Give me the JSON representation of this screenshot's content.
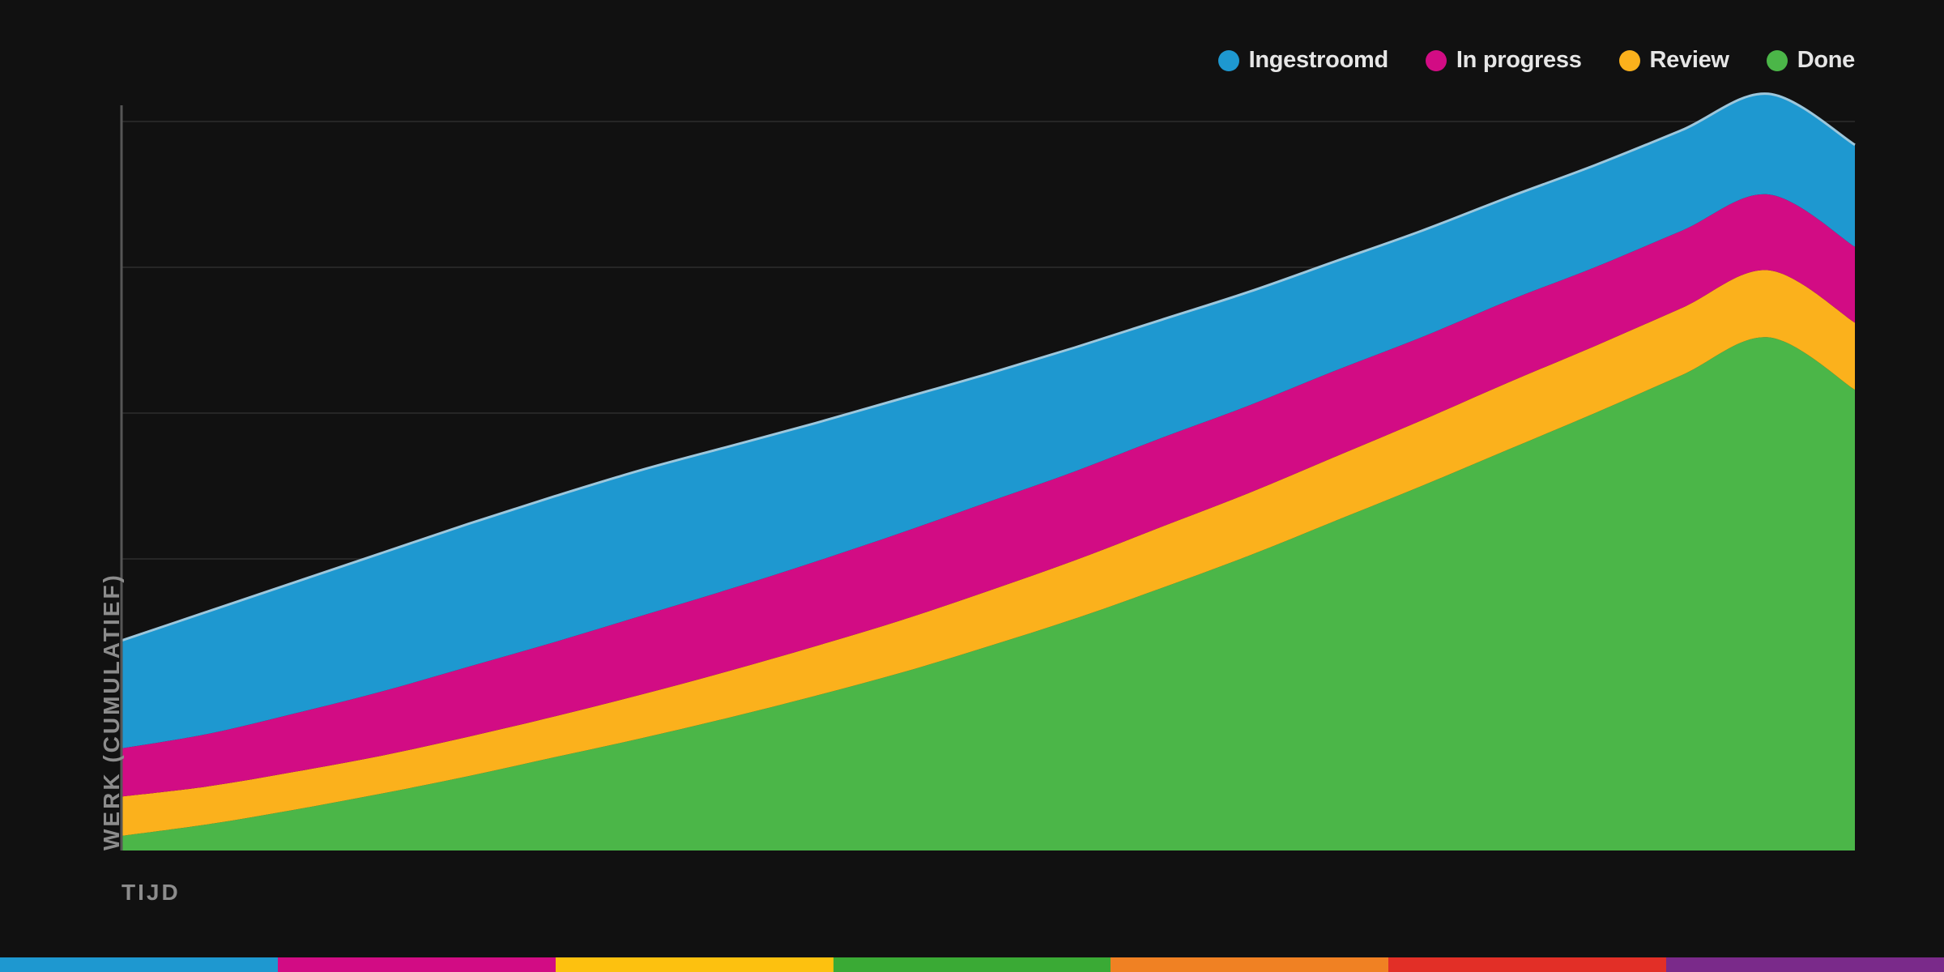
{
  "chart_data": {
    "type": "area",
    "stacked": true,
    "title": "",
    "xlabel": "TIJD",
    "ylabel": "WERK (CUMULATIEF)",
    "ylim": [
      0,
      5
    ],
    "grid": true,
    "legend_position": "top-right",
    "x": [
      0,
      1,
      2,
      3,
      4,
      5,
      6,
      7,
      8,
      9,
      10,
      11,
      12,
      13,
      14,
      15,
      16,
      17,
      18,
      19,
      20
    ],
    "series": [
      {
        "name": "Done",
        "color": "#4bb648",
        "values": [
          0.1,
          0.18,
          0.28,
          0.39,
          0.51,
          0.64,
          0.77,
          0.91,
          1.06,
          1.22,
          1.4,
          1.59,
          1.8,
          2.02,
          2.26,
          2.5,
          2.75,
          3.0,
          3.26,
          3.52,
          3.16
        ]
      },
      {
        "name": "Review",
        "color": "#fbb11c",
        "values": [
          0.27,
          0.26,
          0.26,
          0.26,
          0.27,
          0.28,
          0.3,
          0.32,
          0.34,
          0.36,
          0.38,
          0.4,
          0.42,
          0.43,
          0.44,
          0.45,
          0.46,
          0.46,
          0.46,
          0.46,
          0.46
        ]
      },
      {
        "name": "In progress",
        "color": "#d20c84",
        "values": [
          0.33,
          0.36,
          0.4,
          0.44,
          0.48,
          0.51,
          0.54,
          0.56,
          0.58,
          0.6,
          0.61,
          0.61,
          0.61,
          0.6,
          0.59,
          0.57,
          0.56,
          0.54,
          0.53,
          0.52,
          0.52
        ]
      },
      {
        "name": "Ingestroomd",
        "color": "#1e98d0",
        "values": [
          0.74,
          0.84,
          0.9,
          0.95,
          0.98,
          1.0,
          1.0,
          0.98,
          0.95,
          0.92,
          0.88,
          0.85,
          0.81,
          0.78,
          0.75,
          0.73,
          0.71,
          0.7,
          0.69,
          0.69,
          0.7
        ]
      }
    ]
  },
  "legend": {
    "items": [
      {
        "label": "Ingestroomd",
        "color": "#1e98d0"
      },
      {
        "label": "In progress",
        "color": "#d20c84"
      },
      {
        "label": "Review",
        "color": "#fbb11c"
      },
      {
        "label": "Done",
        "color": "#4bb648"
      }
    ]
  },
  "outline_color": "#9dc7dc",
  "stripe_colors": [
    "#1e98d0",
    "#d20c84",
    "#fdc10f",
    "#3aaa35",
    "#f08123",
    "#e22f27",
    "#7a2a8a"
  ]
}
